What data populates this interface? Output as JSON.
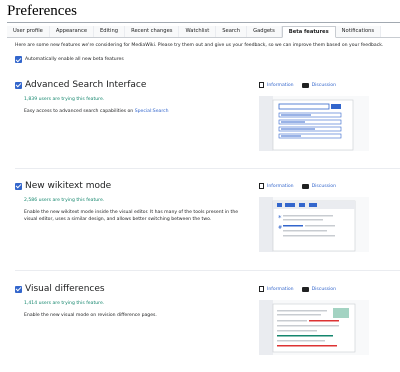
{
  "page": {
    "title": "Preferences"
  },
  "tabs": [
    {
      "label": "User profile",
      "active": false
    },
    {
      "label": "Appearance",
      "active": false
    },
    {
      "label": "Editing",
      "active": false
    },
    {
      "label": "Recent changes",
      "active": false
    },
    {
      "label": "Watchlist",
      "active": false
    },
    {
      "label": "Search",
      "active": false
    },
    {
      "label": "Gadgets",
      "active": false
    },
    {
      "label": "Beta features",
      "active": true
    },
    {
      "label": "Notifications",
      "active": false
    }
  ],
  "intro": "Here are some new features we're considering for MediaWiki. Please try them out and give us your feedback, so we can improve them based on your feedback.",
  "auto_enable": {
    "label": "Automatically enable all new beta features",
    "checked": true
  },
  "features": [
    {
      "title": "Advanced Search Interface",
      "checked": true,
      "users": "1,839 users are trying this feature.",
      "desc_text": "Easy access to advanced search capabilities on ",
      "desc_link": "Special:Search",
      "info_label": "Information",
      "discussion_label": "Discussion",
      "illustration": "advanced-search-illustration"
    },
    {
      "title": "New wikitext mode",
      "checked": true,
      "users": "2,586 users are trying this feature.",
      "desc_text": "Enable the new wikitext mode inside the visual editor. It has many of the tools present in the visual editor, uses a similar design, and allows better switching between the two.",
      "info_label": "Information",
      "discussion_label": "Discussion",
      "illustration": "wikitext-editor-illustration"
    },
    {
      "title": "Visual differences",
      "checked": true,
      "users": "1,414 users are trying this feature.",
      "desc_text": "Enable the new visual mode on revision difference pages.",
      "info_label": "Information",
      "discussion_label": "Discussion",
      "illustration": "visual-diff-illustration"
    }
  ],
  "colors": {
    "accent": "#3366cc",
    "users_green": "#14866d",
    "illustration_bg": "#eaecf0"
  }
}
